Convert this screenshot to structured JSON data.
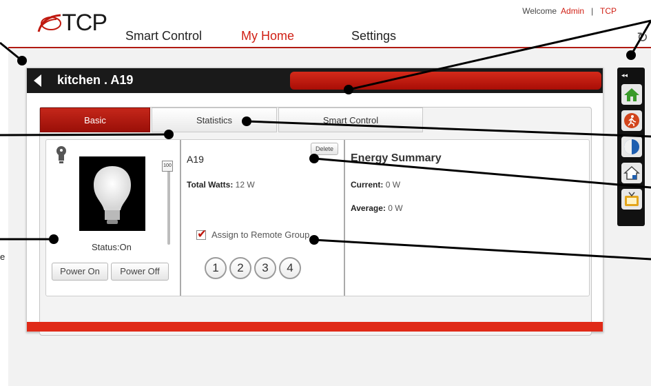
{
  "app": {
    "logo_text": "TCP",
    "welcome_prefix": "Welcome",
    "user": "Admin",
    "separator": "|",
    "brand_link": "TCP"
  },
  "nav": {
    "items": [
      {
        "label": "Smart Control",
        "active": false
      },
      {
        "label": "My Home",
        "active": true
      },
      {
        "label": "Settings",
        "active": false
      }
    ]
  },
  "panel": {
    "title": "kitchen . A19"
  },
  "tabs": [
    {
      "label": "Basic",
      "active": true
    },
    {
      "label": "Statistics",
      "active": false
    },
    {
      "label": "Smart Control",
      "active": false
    }
  ],
  "device": {
    "slider_value": "100",
    "status": "Status:On",
    "power_on": "Power On",
    "power_off": "Power Off",
    "name": "A19",
    "delete_label": "Delete",
    "total_watts_label": "Total Watts:",
    "total_watts_value": "12 W",
    "assign_label": "Assign to Remote Group",
    "assign_checked": true,
    "groups": [
      "1",
      "2",
      "3",
      "4"
    ]
  },
  "energy": {
    "title": "Energy Summary",
    "current_label": "Current:",
    "current_value": "0 W",
    "average_label": "Average:",
    "average_value": "0 W"
  },
  "sidebar": {
    "collapse_label": "◂◂",
    "buttons": [
      {
        "icon": "home-icon"
      },
      {
        "icon": "activity-icon"
      },
      {
        "icon": "moon-icon"
      },
      {
        "icon": "house-lock-icon"
      },
      {
        "icon": "tv-icon"
      }
    ]
  },
  "annotation": {
    "cut_text": "e"
  },
  "colors": {
    "brand_red": "#d01f14",
    "header_black": "#1a1a1a"
  }
}
